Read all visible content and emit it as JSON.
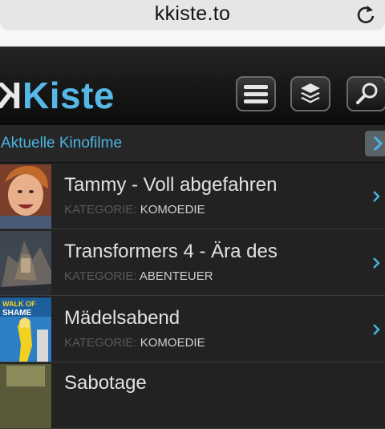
{
  "browser": {
    "url": "kkiste.to",
    "reload_icon": "reload-icon"
  },
  "site": {
    "logo_k": "K",
    "logo_word": "Kiste",
    "accent": "#55b8e6",
    "buttons": [
      "menu-icon",
      "layers-icon",
      "search-icon"
    ]
  },
  "section": {
    "title": "Aktuelle Kinofilme"
  },
  "movies": [
    {
      "title": "Tammy - Voll abgefahren",
      "category_label": "KATEGORIE:",
      "category": "KOMOEDIE"
    },
    {
      "title": "Transformers 4 - Ära des",
      "category_label": "KATEGORIE:",
      "category": "ABENTEUER"
    },
    {
      "title": "Mädelsabend",
      "category_label": "KATEGORIE:",
      "category": "KOMOEDIE",
      "poster_text": "WALK OF SHAME"
    },
    {
      "title": "Sabotage"
    }
  ]
}
